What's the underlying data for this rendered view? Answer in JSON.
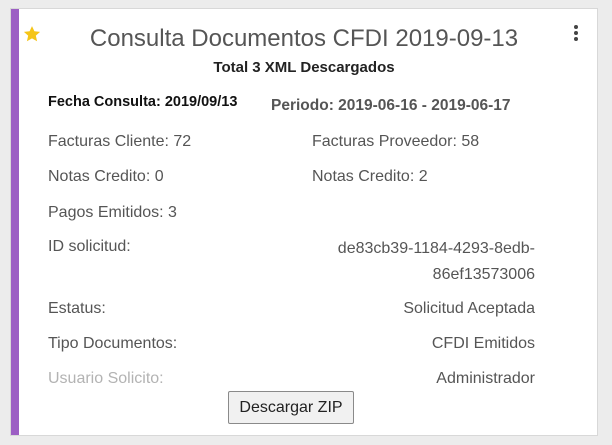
{
  "card": {
    "accent_color": "#9c5fc4",
    "star_color": "#f5c518",
    "star_icon": "star-icon",
    "menu_icon": "more-vert-icon",
    "title": "Consulta Documentos CFDI 2019-09-13",
    "subtitle": "Total 3 XML Descargados",
    "fecha_consulta": "Fecha Consulta: 2019/09/13",
    "periodo": "Periodo: 2019-06-16 - 2019-06-17",
    "facturas_cliente": "Facturas Cliente: 72",
    "facturas_proveedor": "Facturas Proveedor: 58",
    "notas_credito_left": "Notas Credito: 0",
    "notas_credito_right": "Notas Credito: 2",
    "pagos_emitidos": "Pagos Emitidos: 3",
    "id_solicitud_label": "ID solicitud:",
    "id_solicitud_value_line1": "de83cb39-1184-4293-8edb-",
    "id_solicitud_value_line2": "86ef13573006",
    "estatus_label": "Estatus:",
    "estatus_value": "Solicitud Aceptada",
    "tipo_documentos_label": "Tipo Documentos:",
    "tipo_documentos_value": "CFDI Emitidos",
    "usuario_solicito_label": "Usuario Solicito:",
    "usuario_solicito_value": "Administrador",
    "download_button": "Descargar ZIP"
  }
}
